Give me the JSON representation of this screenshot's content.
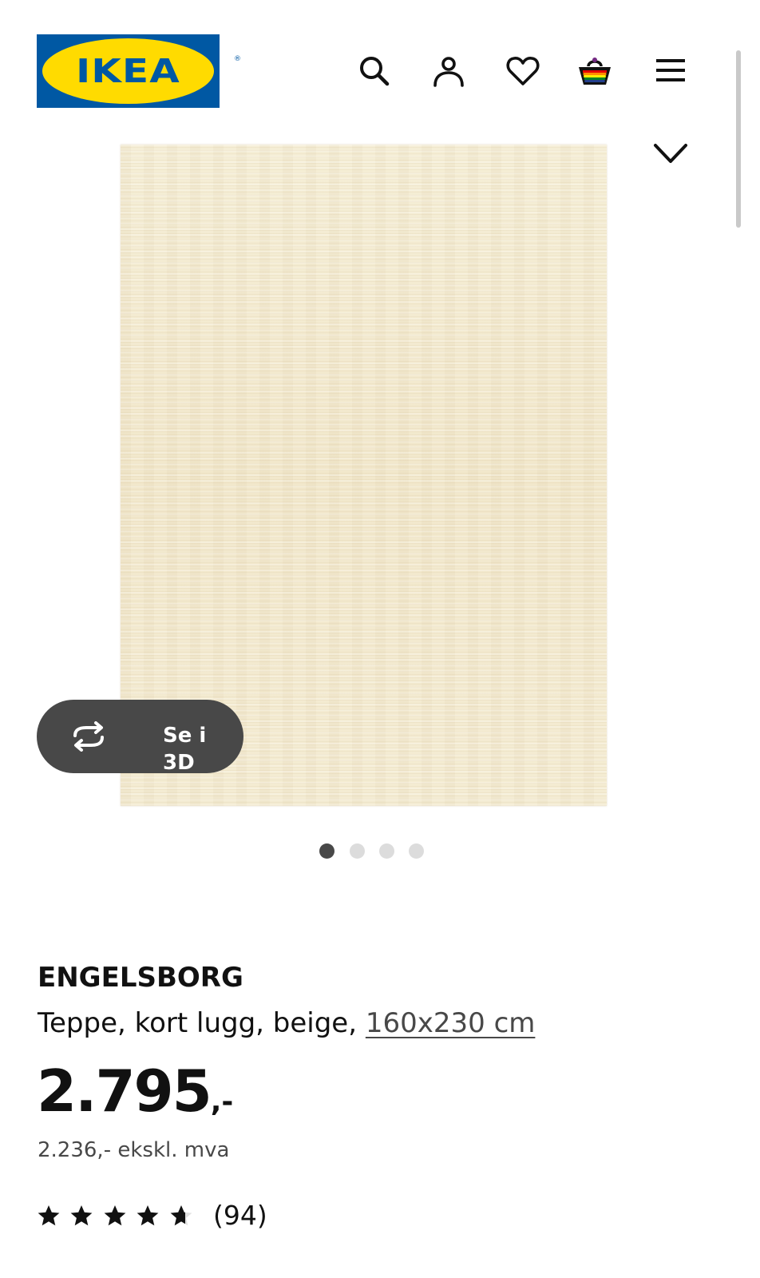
{
  "header": {
    "logo_text": "IKEA",
    "logo_registered": "®",
    "icons": [
      "search-icon",
      "user-icon",
      "heart-icon",
      "basket-icon",
      "menu-icon"
    ]
  },
  "gallery": {
    "view_3d_label": "Se i 3D",
    "dot_count": 4,
    "active_dot": 1
  },
  "product": {
    "name": "ENGELSBORG",
    "description": "Teppe, kort lugg, beige,",
    "size_link": "160x230 cm",
    "price_main": "2.795",
    "price_suffix": ",-",
    "price_ex_vat": "2.236,- ekskl. mva",
    "rating_value": 4.7,
    "rating_max": 5,
    "review_count": "(94)"
  },
  "colors": {
    "ikea_blue": "#0058a3",
    "ikea_yellow": "#ffdb00",
    "button_dark": "#484848",
    "text_primary": "#111111"
  }
}
